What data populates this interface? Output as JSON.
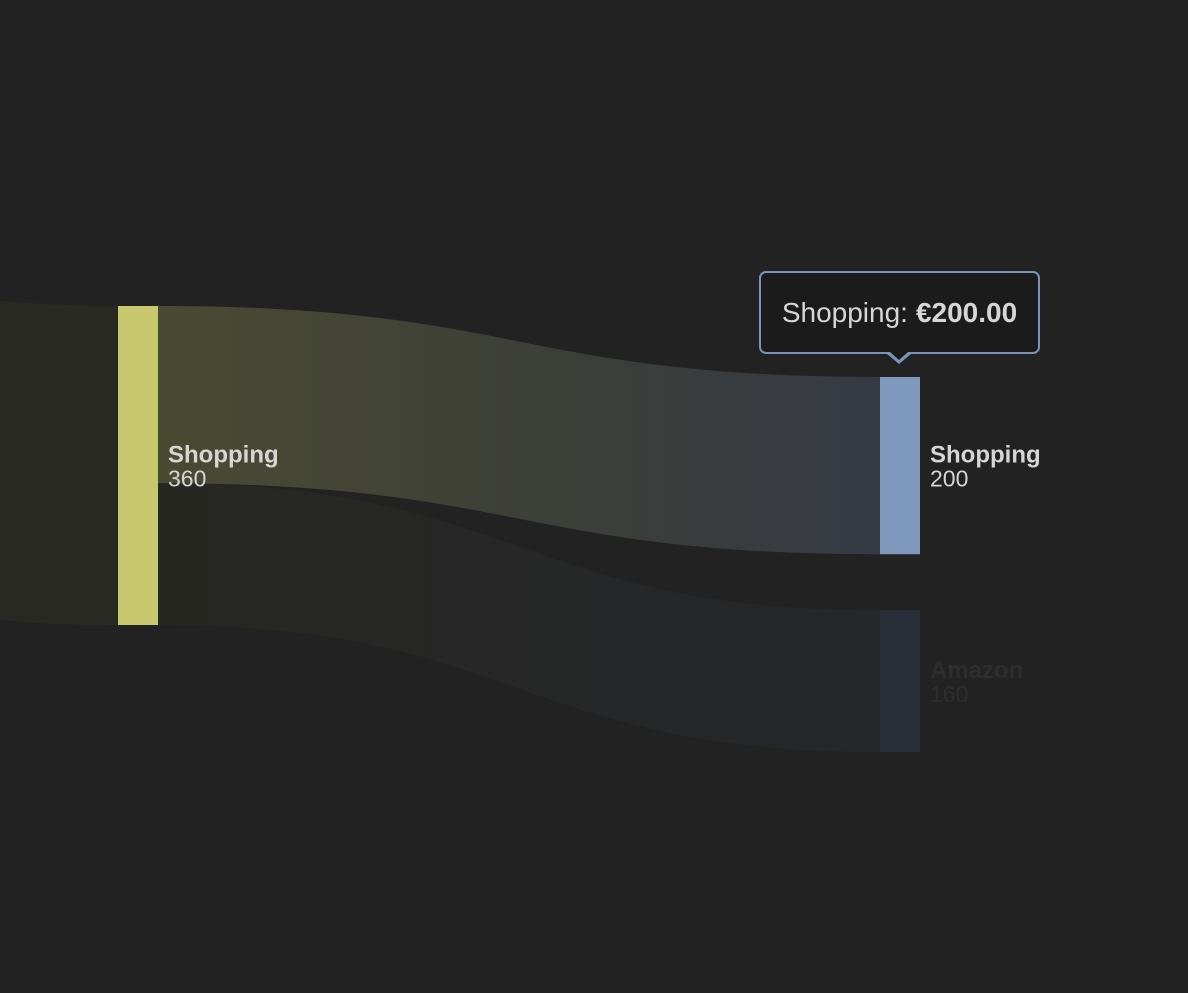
{
  "chart_data": {
    "type": "sankey",
    "currency_symbol": "€",
    "nodes": [
      {
        "id": "src-shopping",
        "name": "Shopping",
        "value": 360,
        "value_label": "360",
        "color": "#c8c96e",
        "column": 0,
        "dimmed": false
      },
      {
        "id": "dst-shopping",
        "name": "Shopping",
        "value": 200,
        "value_label": "200",
        "color": "#7f99bd",
        "column": 1,
        "dimmed": false
      },
      {
        "id": "dst-amazon",
        "name": "Amazon",
        "value": 160,
        "value_label": "160",
        "color": "#2a2e38",
        "column": 1,
        "dimmed": true
      }
    ],
    "links": [
      {
        "source": "src-shopping",
        "target": "dst-shopping",
        "value": 200,
        "highlighted": true
      },
      {
        "source": "src-shopping",
        "target": "dst-amazon",
        "value": 160,
        "highlighted": false
      }
    ],
    "incoming": {
      "target": "src-shopping",
      "value": 360
    }
  },
  "tooltip": {
    "label": "Shopping:",
    "value": "€200.00"
  },
  "colors": {
    "background": "#222222",
    "label_text": "#d6d6d6",
    "dim_label_text": "#2e2e2e",
    "tooltip_border": "#7a93b8",
    "tooltip_background": "#1b1b1b"
  }
}
